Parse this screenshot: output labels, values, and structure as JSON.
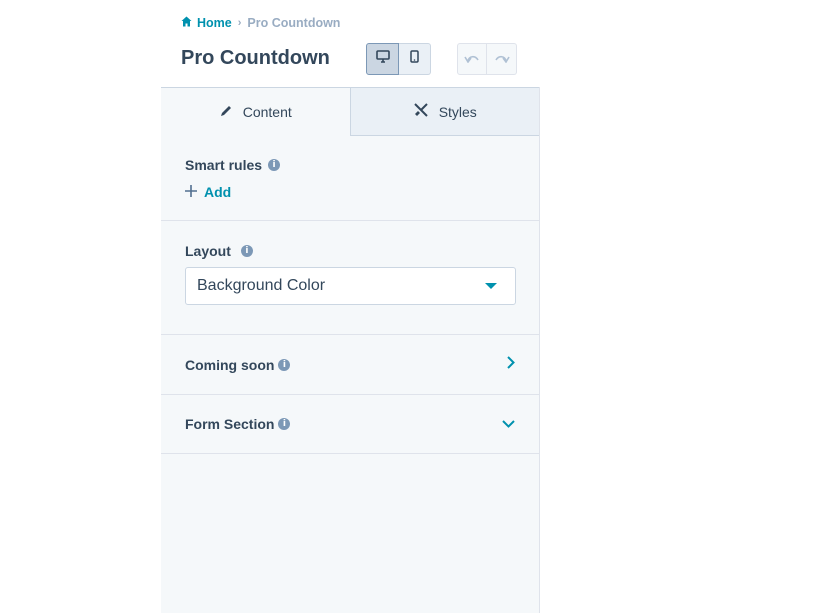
{
  "breadcrumb": {
    "home": "Home",
    "separator": "›",
    "current": "Pro Countdown"
  },
  "page_title": "Pro Countdown",
  "tabs": [
    {
      "label": "Content",
      "icon": "pencil-icon",
      "active": true
    },
    {
      "label": "Styles",
      "icon": "brush-icon",
      "active": false
    }
  ],
  "smart_rules": {
    "label": "Smart rules",
    "add_label": "Add"
  },
  "layout": {
    "label": "Layout",
    "selected": "Background Color"
  },
  "sections": [
    {
      "label": "Coming soon",
      "state": "collapsed"
    },
    {
      "label": "Form Section",
      "state": "expanded"
    }
  ],
  "colors": {
    "accent": "#0091ae",
    "text": "#33475b",
    "panel": "#f5f8fa",
    "border": "#dfe3eb"
  }
}
